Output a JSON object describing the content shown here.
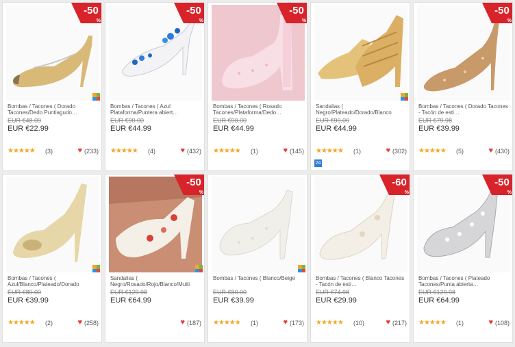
{
  "colors": {
    "sale": "#d8232a",
    "star": "#f5a623",
    "heart": "#e53935"
  },
  "products": [
    {
      "name": "Bombas / Tacones ( Dorado Tacones/Dedo Puntiagudo…",
      "old": "EUR €48.00",
      "price": "EUR €22.99",
      "stars": "★★★★★",
      "reviews": "(3)",
      "likes": "(233)",
      "sale": "-50",
      "badge": "grid"
    },
    {
      "name": "Bombas / Tacones ( Azul Plataforma/Puntera abiert…",
      "old": "EUR €90.00",
      "price": "EUR €44.99",
      "stars": "★★★★★",
      "reviews": "(4)",
      "likes": "(432)",
      "sale": "-50",
      "badge": ""
    },
    {
      "name": "Bombas / Tacones ( Rosado Tacones/Plataforma/Dedo…",
      "old": "EUR €90.00",
      "price": "EUR €44.99",
      "stars": "★★★★★",
      "reviews": "(1)",
      "likes": "(145)",
      "sale": "-50",
      "badge": ""
    },
    {
      "name": "Sandalias ( Negro/Plateado/Dorado/Blanco",
      "old": "EUR €90.00",
      "price": "EUR €44.99",
      "stars": "★★★★★",
      "reviews": "(1)",
      "likes": "(302)",
      "sale": "",
      "badge": "grid"
    },
    {
      "name": "Bombas / Tacones ( Dorado Tacones - Tacón de esti…",
      "old": "EUR €79.98",
      "price": "EUR €39.99",
      "stars": "★★★★★",
      "reviews": "(5)",
      "likes": "(430)",
      "sale": "-50",
      "badge": ""
    },
    {
      "name": "Bombas / Tacones ( Azul/Blanco/Plateado/Dorado",
      "old": "EUR €80.00",
      "price": "EUR €39.99",
      "stars": "★★★★★",
      "reviews": "(2)",
      "likes": "(258)",
      "sale": "",
      "badge": "grid"
    },
    {
      "name": "Sandalias ( Negro/Rosado/Rojo/Blanco/Multi",
      "old": "EUR €129.98",
      "price": "EUR €64.99",
      "stars": "",
      "reviews": "",
      "likes": "(187)",
      "sale": "-50",
      "badge": "grid"
    },
    {
      "name": "Bombas / Tacones ( Blanco/Beige",
      "old": "EUR €80.00",
      "price": "EUR €39.99",
      "stars": "★★★★★",
      "reviews": "(1)",
      "likes": "(173)",
      "sale": "",
      "badge": "grid"
    },
    {
      "name": "Bombas / Tacones ( Blanco Tacones - Tacón de esti…",
      "old": "EUR €74.98",
      "price": "EUR €29.99",
      "stars": "★★★★★",
      "reviews": "(10)",
      "likes": "(217)",
      "sale": "-60",
      "badge": ""
    },
    {
      "name": "Bombas / Tacones ( Plateado Tacones/Punta abierta…",
      "old": "EUR €129.98",
      "price": "EUR €64.99",
      "stars": "★★★★★",
      "reviews": "(1)",
      "likes": "(108)",
      "sale": "-50",
      "badge": ""
    }
  ],
  "app_badge": "24"
}
